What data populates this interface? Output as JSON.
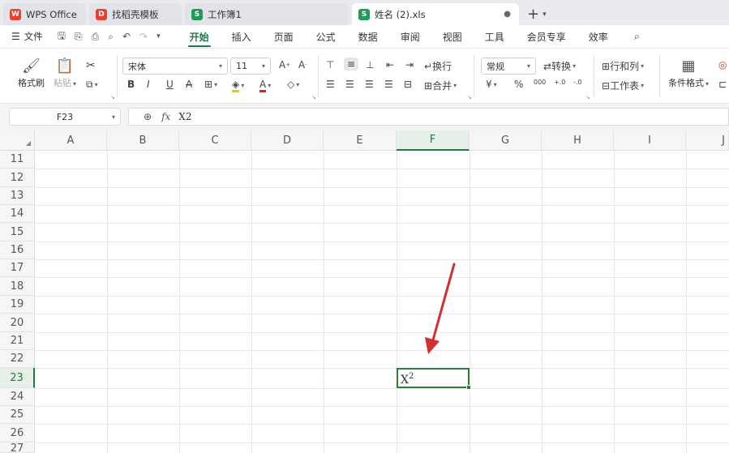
{
  "tabs": [
    {
      "label": "WPS Office",
      "icon": "wps-logo-icon",
      "color": "#e8402e"
    },
    {
      "label": "找稻壳模板",
      "icon": "docer-icon",
      "color": "#e8402e"
    },
    {
      "label": "工作簿1",
      "icon": "sheet-icon",
      "color": "#1f9b57"
    },
    {
      "label": "姓名 (2).xls",
      "icon": "sheet-icon",
      "color": "#1f9b57"
    }
  ],
  "menubar": {
    "file_label": "文件",
    "tabs": [
      "开始",
      "插入",
      "页面",
      "公式",
      "数据",
      "审阅",
      "视图",
      "工具",
      "会员专享",
      "效率"
    ]
  },
  "ribbon": {
    "format_painter": "格式刷",
    "paste": "粘贴",
    "font_name": "宋体",
    "font_size": "11",
    "wrap": "换行",
    "merge": "合并",
    "number_format": "常规",
    "convert": "转换",
    "row_col": "行和列",
    "worksheet": "工作表",
    "cond_format": "条件格式"
  },
  "formula_bar": {
    "name_box": "F23",
    "fx": "fx",
    "formula_text": "X2"
  },
  "grid": {
    "columns": [
      "A",
      "B",
      "C",
      "D",
      "E",
      "F",
      "G",
      "H",
      "I",
      "J"
    ],
    "rows": [
      "11",
      "12",
      "13",
      "14",
      "15",
      "16",
      "17",
      "18",
      "19",
      "20",
      "21",
      "22",
      "23",
      "24",
      "25",
      "26",
      "27"
    ],
    "selected_column": "F",
    "selected_row": "23",
    "cell_base": "X",
    "cell_superscript": "2"
  },
  "colors": {
    "accent": "#1f7b42",
    "arrow": "#d32f2f"
  }
}
